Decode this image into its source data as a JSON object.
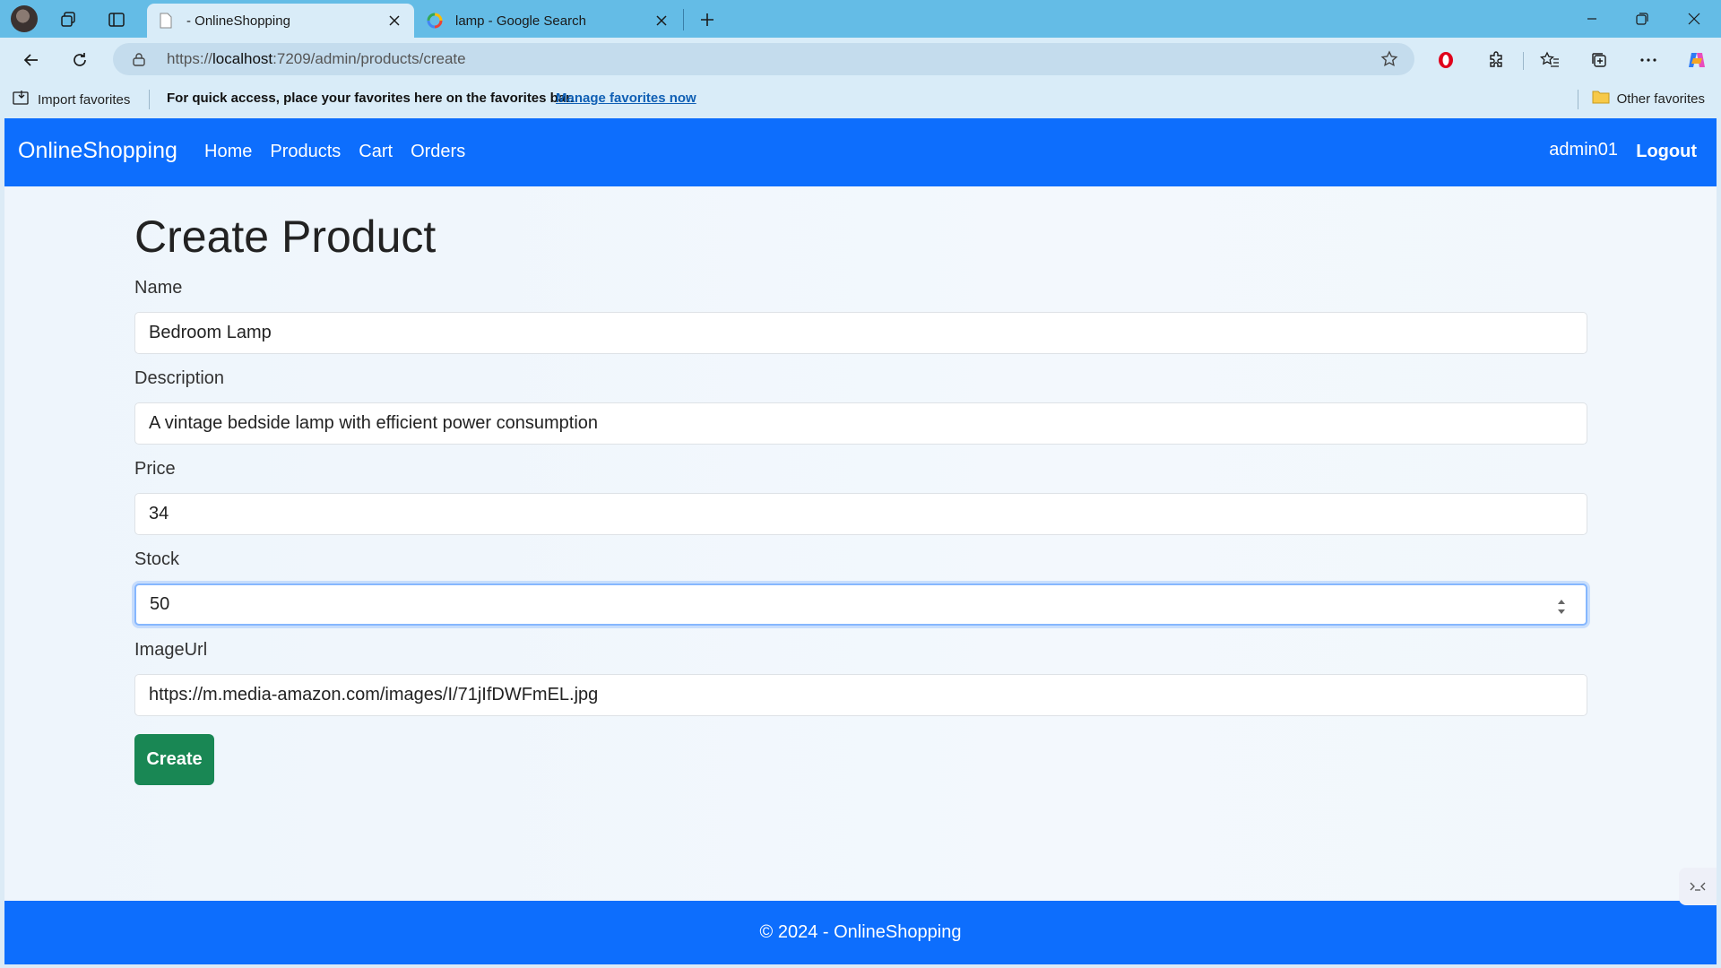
{
  "browser": {
    "tabs": [
      {
        "title": "- OnlineShopping",
        "active": true
      },
      {
        "title": "lamp - Google Search",
        "active": false
      }
    ],
    "address": {
      "prefix": "https://",
      "host": "localhost",
      "rest": ":7209/admin/products/create"
    },
    "favorites_bar": {
      "import_label": "Import favorites",
      "message": "For quick access, place your favorites here on the favorites bar.",
      "manage_link": "Manage favorites now",
      "other_label": "Other favorites"
    }
  },
  "navbar": {
    "brand": "OnlineShopping",
    "links": [
      "Home",
      "Products",
      "Cart",
      "Orders"
    ],
    "user": "admin01",
    "logout": "Logout"
  },
  "form": {
    "title": "Create Product",
    "fields": [
      {
        "label": "Name",
        "value": "Bedroom Lamp"
      },
      {
        "label": "Description",
        "value": "A vintage bedside lamp with efficient power consumption"
      },
      {
        "label": "Price",
        "value": "34"
      },
      {
        "label": "Stock",
        "value": "50"
      },
      {
        "label": "ImageUrl",
        "value": "https://m.media-amazon.com/images/I/71jIfDWFmEL.jpg"
      }
    ],
    "submit_label": "Create"
  },
  "footer": {
    "text": "© 2024 - OnlineShopping"
  },
  "colors": {
    "primary": "#0d6efd",
    "success": "#198754",
    "chrome": "#64bce6"
  }
}
